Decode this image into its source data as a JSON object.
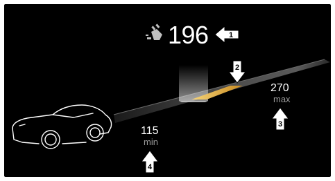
{
  "display": {
    "current_range": "196",
    "max_value": "270",
    "max_unit": "max",
    "min_value": "115",
    "min_unit": "min"
  },
  "callouts": [
    "1",
    "2",
    "3",
    "4"
  ],
  "icons": {
    "charging_plug": "charging-plug-icon",
    "vehicle": "car-silhouette-icon"
  },
  "colors": {
    "background": "#000000",
    "text": "#ffffff",
    "unit_text": "#9a9a9a",
    "range_highlight": "#e6b040"
  }
}
